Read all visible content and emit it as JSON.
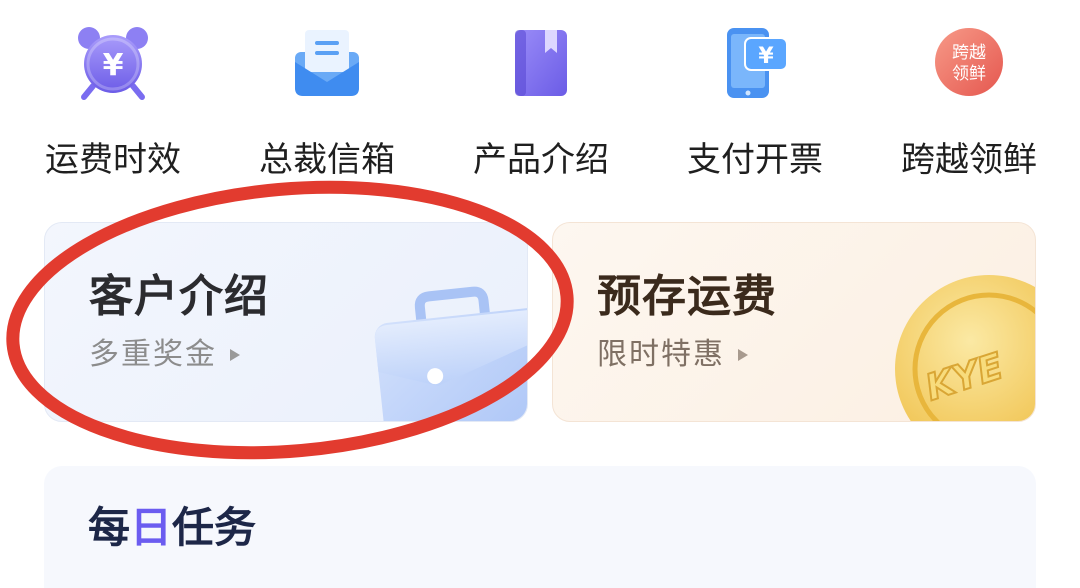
{
  "quick_menu": {
    "items": [
      {
        "label": "运费时效",
        "icon": "alarm-clock-yen-icon"
      },
      {
        "label": "总裁信箱",
        "icon": "envelope-icon"
      },
      {
        "label": "产品介绍",
        "icon": "book-icon"
      },
      {
        "label": "支付开票",
        "icon": "phone-yen-icon"
      },
      {
        "label": "跨越领鲜",
        "icon": "kuayue-fresh-logo-icon"
      }
    ],
    "currency_symbol": "¥",
    "logo_text_line1": "跨越",
    "logo_text_line2": "领鲜"
  },
  "promo_cards": {
    "referral": {
      "title": "客户介绍",
      "subtitle": "多重奖金",
      "icon": "briefcase-icon",
      "arrow_icon": "play-right-icon"
    },
    "prepay": {
      "title": "预存运费",
      "subtitle": "限时特惠",
      "icon": "gold-coin-icon",
      "arrow_icon": "play-right-icon",
      "coin_text": "KYE"
    }
  },
  "daily_tasks": {
    "title_before": "每",
    "title_highlight": "日",
    "title_after": "任务"
  },
  "colors": {
    "accent_purple": "#6b5cf0",
    "accent_blue": "#3f8cf0",
    "logo_red": "#e85a5a",
    "coin_gold": "#f0c14b",
    "annotation_red": "#e23b2f",
    "text_primary": "#1f1f1f",
    "text_secondary": "#8c8c8c"
  }
}
